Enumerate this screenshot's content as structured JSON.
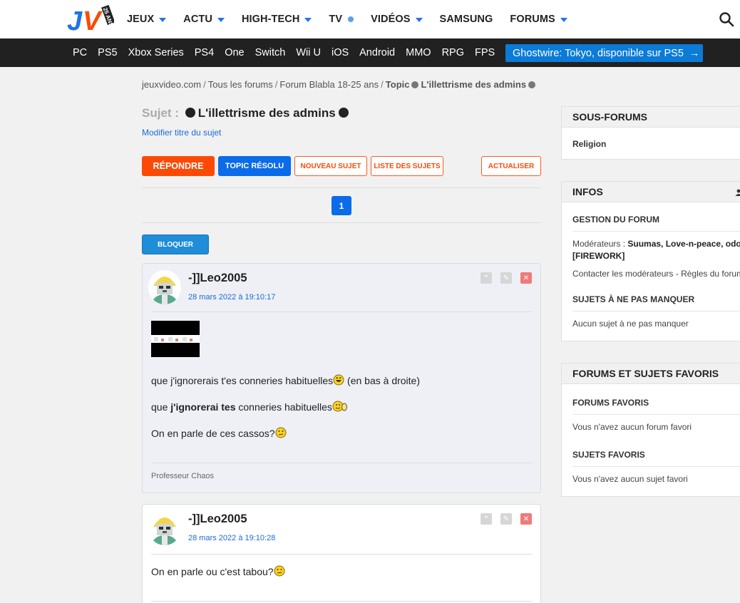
{
  "header": {
    "logo_text": "JV",
    "logo_badge": "25 ANS",
    "nav": [
      {
        "label": "JEUX",
        "marker": "caret"
      },
      {
        "label": "ACTU",
        "marker": "caret"
      },
      {
        "label": "HIGH-TECH",
        "marker": "caret"
      },
      {
        "label": "TV",
        "marker": "dot"
      },
      {
        "label": "VIDÉOS",
        "marker": "caret"
      },
      {
        "label": "SAMSUNG",
        "marker": "none"
      },
      {
        "label": "FORUMS",
        "marker": "caret"
      }
    ]
  },
  "platforms": [
    "PC",
    "PS5",
    "Xbox Series",
    "PS4",
    "One",
    "Switch",
    "Wii U",
    "iOS",
    "Android",
    "MMO",
    "RPG",
    "FPS"
  ],
  "promo": {
    "label": "Ghostwire: Tokyo, disponible sur PS5",
    "arrow": "→"
  },
  "breadcrumb": {
    "items": [
      "jeuxvideo.com",
      "Tous les forums",
      "Forum Blabla 18-25 ans"
    ],
    "sep": "/",
    "current_prefix": "Topic",
    "current_title": "L'illettrisme des admins"
  },
  "topic": {
    "label": "Sujet :",
    "title": "L'illettrisme des admins",
    "modify_link": "Modifier titre du sujet"
  },
  "actions": {
    "reply": "RÉPONDRE",
    "resolved": "TOPIC RÉSOLU",
    "new_subject": "NOUVEAU SUJET",
    "list_subjects": "LISTE DES SUJETS",
    "refresh": "ACTUALISER",
    "block": "BLOQUER"
  },
  "pagination": {
    "current": "1"
  },
  "posts": [
    {
      "author": "-]]Leo2005",
      "date": "28 mars 2022 à 19:10:17",
      "line1": "que j'ignorerais t'es conneries habituelles",
      "line1_after": " (en bas à droite)",
      "line2_pre": "que ",
      "line2_bold": "j'ignorerai tes",
      "line2_post": " conneries habituelles",
      "line3": "On en parle de ces cassos?",
      "signature": "Professeur Chaos"
    },
    {
      "author": "-]]Leo2005",
      "date": "28 mars 2022 à 19:10:28",
      "line1": "On en parle ou c'est tabou?"
    }
  ],
  "post_icons": {
    "quote": "\"",
    "edit": "✎",
    "delete": "✕"
  },
  "sidebar": {
    "subforums": {
      "title": "SOUS-FORUMS",
      "items": [
        "Religion"
      ]
    },
    "infos": {
      "title": "INFOS",
      "management_title": "GESTION DU FORUM",
      "moderators_label": "Modérateurs : ",
      "moderators_names": "Suumas, Love-n-peace, odo",
      "moderators_line2": "[FIREWORK]",
      "contact": "Contacter les modérateurs - Règles du forum",
      "must_see_title": "SUJETS À NE PAS MANQUER",
      "must_see_empty": "Aucun sujet à ne pas manquer"
    },
    "favorites": {
      "title": "FORUMS ET SUJETS FAVORIS",
      "forums_title": "FORUMS FAVORIS",
      "forums_empty": "Vous n'avez aucun forum favori",
      "subjects_title": "SUJETS FAVORIS",
      "subjects_empty": "Vous n'avez aucun sujet favori"
    }
  }
}
